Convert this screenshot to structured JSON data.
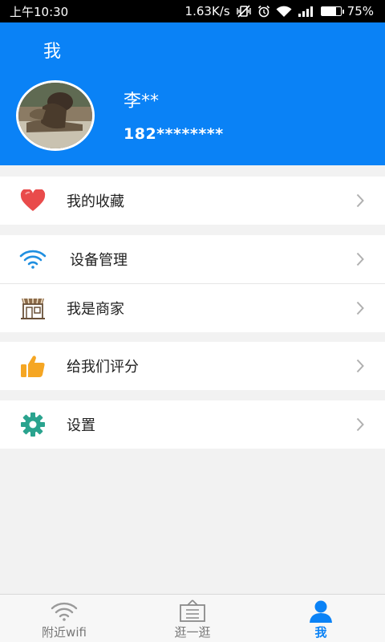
{
  "status_bar": {
    "time": "上午10:30",
    "network_speed": "1.63K/s",
    "battery_percent": "75%",
    "battery_level": 0.75
  },
  "header": {
    "title": "我",
    "username": "李**",
    "phone": "182********"
  },
  "menu": {
    "favorites": {
      "label": "我的收藏",
      "icon": "heart-icon"
    },
    "device_management": {
      "label": "设备管理",
      "icon": "wifi-icon"
    },
    "merchant": {
      "label": "我是商家",
      "icon": "storefront-icon"
    },
    "rate_us": {
      "label": "给我们评分",
      "icon": "thumbs-up-icon"
    },
    "settings": {
      "label": "设置",
      "icon": "gear-icon"
    }
  },
  "bottom_nav": {
    "items": [
      {
        "label": "附近wifi",
        "icon": "wifi-icon"
      },
      {
        "label": "逛一逛",
        "icon": "signboard-icon"
      },
      {
        "label": "我",
        "icon": "person-icon"
      }
    ],
    "active": "我"
  },
  "colors": {
    "primary": "#0a82f6",
    "heart": "#e94b4b",
    "thumbs_up": "#f5a623",
    "gear": "#2aa38e",
    "wifi_menu": "#1f8fe0"
  }
}
